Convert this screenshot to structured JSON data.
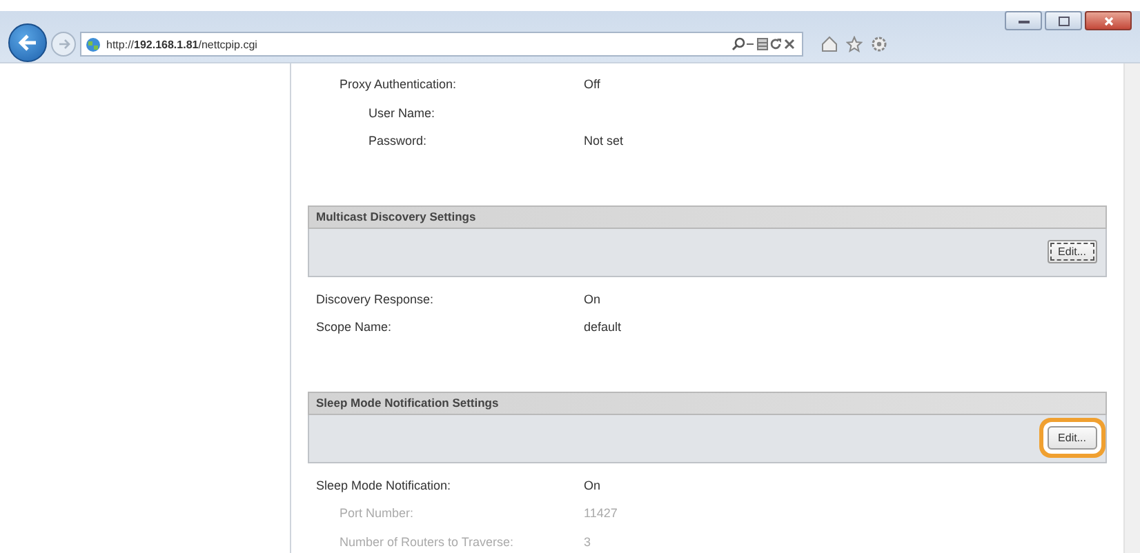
{
  "browser": {
    "address": "http://**192.168.1.81**/nettcpip.cgi"
  },
  "sections": [
    {
      "rows": [
        {
          "label": "Proxy Authentication:",
          "value": "Off",
          "disabled": false,
          "children": [
            {
              "label": "User Name:",
              "disabled": false
            },
            {
              "label": "Password:",
              "value": "Not set",
              "disabled": false
            }
          ]
        }
      ]
    },
    {
      "title": "Multicast Discovery Settings",
      "button": {
        "label": "Edit...",
        "focused": true,
        "highlighted": false
      },
      "rows": [
        {
          "label": "Discovery Response:",
          "value": "On",
          "disabled": false
        },
        {
          "label": "Scope Name:",
          "value": "default",
          "disabled": false
        }
      ]
    },
    {
      "title": "Sleep Mode Notification Settings",
      "button": {
        "label": "Edit...",
        "focused": false,
        "highlighted": true
      },
      "rows": [
        {
          "label": "Sleep Mode Notification:",
          "value": "On",
          "disabled": false,
          "children": [
            {
              "label": "Port Number:",
              "value": "11427",
              "disabled": true
            },
            {
              "label": "Number of Routers to Traverse:",
              "value": "3",
              "disabled": true
            }
          ]
        }
      ]
    }
  ]
}
